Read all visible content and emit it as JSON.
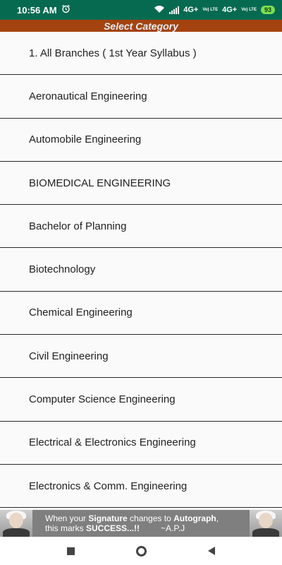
{
  "status": {
    "time": "10:56 AM",
    "network1": "4G+",
    "network2": "4G+",
    "volte": "Vo) LTE",
    "battery": "93"
  },
  "header": {
    "title": "Select Category"
  },
  "categories": [
    "1. All Branches ( 1st Year Syllabus )",
    "Aeronautical Engineering",
    "Automobile Engineering",
    "BIOMEDICAL ENGINEERING",
    "Bachelor of Planning",
    "Biotechnology",
    "Chemical Engineering",
    "Civil Engineering",
    "Computer Science Engineering",
    "Electrical & Electronics Engineering",
    "Electronics & Comm. Engineering"
  ],
  "banner": {
    "line1_prefix": "When your ",
    "line1_bold1": "Signature",
    "line1_mid": " changes to ",
    "line1_bold2": "Autograph",
    "line1_suffix": ",",
    "line2_prefix": "this marks ",
    "line2_bold": "SUCCESS...!!",
    "line2_author": "~A.P.J"
  },
  "colors": {
    "status_bar": "#066a50",
    "header": "#a4430f",
    "banner": "#7f7f7f"
  }
}
